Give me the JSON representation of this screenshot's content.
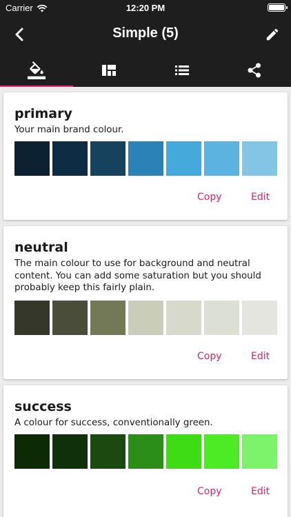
{
  "status_bar": {
    "carrier": "Carrier",
    "time": "12:20 PM"
  },
  "header": {
    "title": "Simple (5)",
    "back_icon": "chevron-left-icon",
    "edit_icon": "pencil-icon"
  },
  "tabs": [
    {
      "name": "paint-bucket-icon",
      "active": true
    },
    {
      "name": "grid-icon",
      "active": false
    },
    {
      "name": "list-icon",
      "active": false
    },
    {
      "name": "share-icon",
      "active": false
    }
  ],
  "accent_color": "#e0236b",
  "cards": [
    {
      "title": "primary",
      "description": "Your main brand colour.",
      "swatches": [
        "#0c2233",
        "#0f2c45",
        "#17425e",
        "#2a82b6",
        "#46a9dc",
        "#5cb3e0",
        "#84c5e6"
      ],
      "copy_label": "Copy",
      "edit_label": "Edit"
    },
    {
      "title": "neutral",
      "description": "The main colour to use for background and neutral content. You can add some saturation but you should probably keep this fairly plain.",
      "swatches": [
        "#35372a",
        "#4a4d3a",
        "#737856",
        "#cbcdbb",
        "#d6d9cb",
        "#dcdfd3",
        "#e4e5df"
      ],
      "copy_label": "Copy",
      "edit_label": "Edit"
    },
    {
      "title": "success",
      "description": "A colour for success, conventionally green.",
      "swatches": [
        "#0d2a06",
        "#0f300a",
        "#1a4a10",
        "#2a8e18",
        "#3ddc14",
        "#4deb26",
        "#7df36c"
      ],
      "copy_label": "Copy",
      "edit_label": "Edit"
    }
  ]
}
